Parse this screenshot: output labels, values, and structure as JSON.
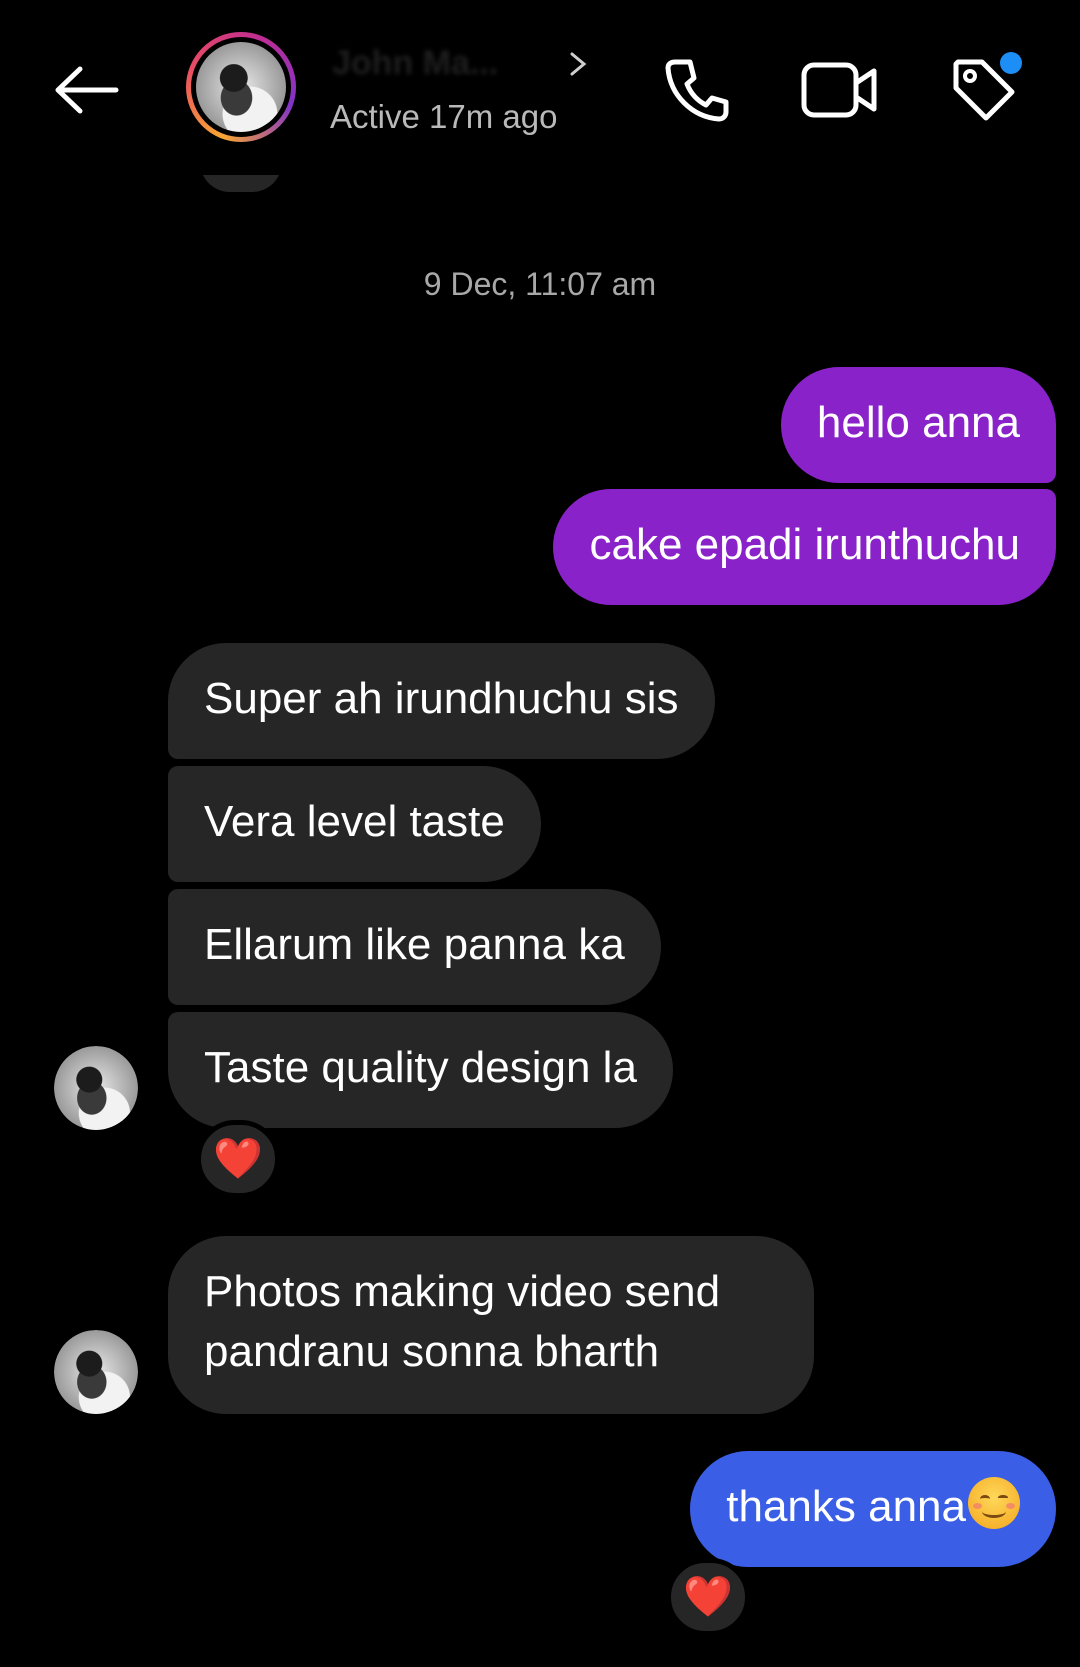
{
  "header": {
    "contact_name": "John Ma...",
    "status": "Active 17m ago",
    "icons": {
      "back": "back-arrow-icon",
      "phone": "phone-icon",
      "video": "video-camera-icon",
      "tag": "tag-icon"
    },
    "notification_dot_color": "#1c8ef5"
  },
  "thread": {
    "timestamp": "9 Dec, 11:07 am",
    "messages": [
      {
        "from": "me",
        "text": "hello anna"
      },
      {
        "from": "me",
        "text": "cake epadi irunthuchu"
      },
      {
        "from": "them",
        "text": "Super ah irundhuchu sis"
      },
      {
        "from": "them",
        "text": "Vera level taste"
      },
      {
        "from": "them",
        "text": "Ellarum like panna ka"
      },
      {
        "from": "them",
        "text": "Taste quality design la",
        "reaction": "❤️"
      },
      {
        "from": "them",
        "text": "Photos making video send pandranu sonna bharth"
      },
      {
        "from": "me",
        "text": "thanks anna",
        "emoji": "smiling-face-icon",
        "reaction": "❤️"
      }
    ]
  },
  "colors": {
    "outgoing_purple": "#8a22c9",
    "outgoing_blue": "#3a5ee5",
    "incoming": "#262626",
    "reaction_heart": "#ee1d2a"
  }
}
